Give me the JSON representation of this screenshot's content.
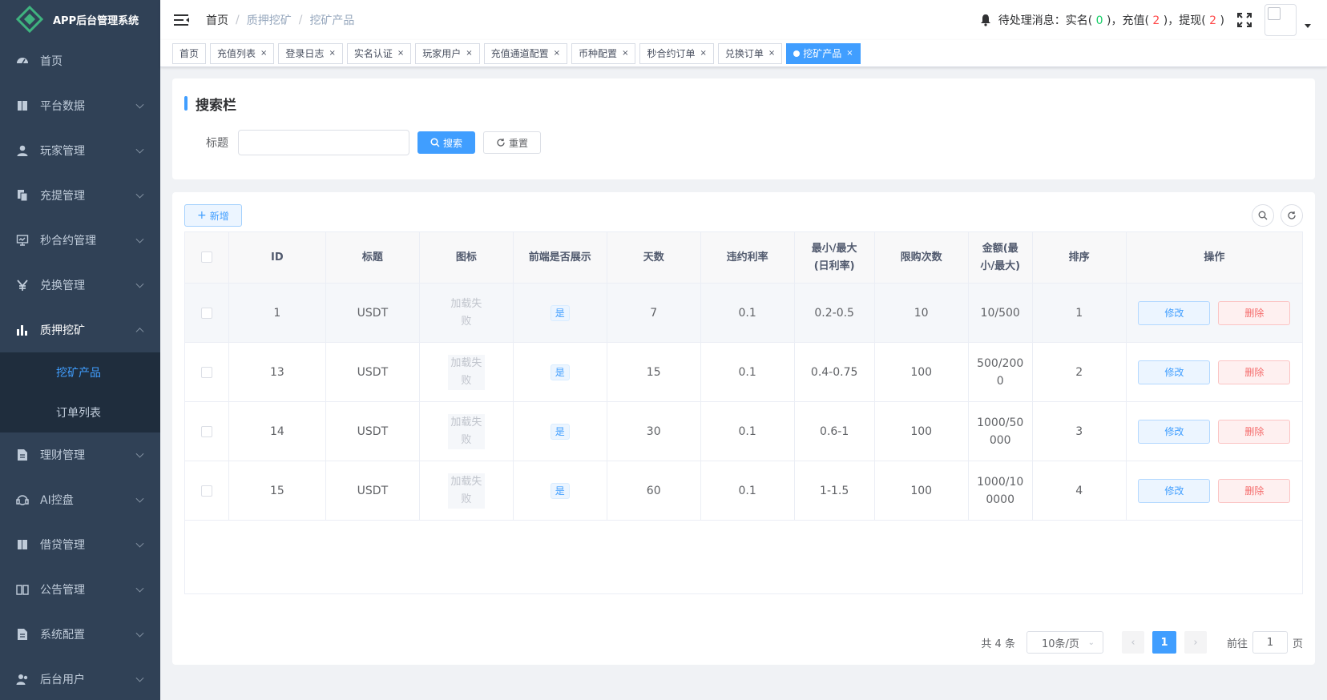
{
  "app": {
    "title": "APP后台管理系统"
  },
  "sidebar": {
    "items": [
      {
        "label": "首页",
        "icon": "dashboard-icon"
      },
      {
        "label": "平台数据",
        "icon": "book-icon"
      },
      {
        "label": "玩家管理",
        "icon": "user-icon"
      },
      {
        "label": "充提管理",
        "icon": "copy-icon"
      },
      {
        "label": "秒合约管理",
        "icon": "monitor-icon"
      },
      {
        "label": "兑换管理",
        "icon": "yen-icon"
      },
      {
        "label": "质押挖矿",
        "icon": "bar-chart-icon"
      },
      {
        "label": "理财管理",
        "icon": "document-icon"
      },
      {
        "label": "AI控盘",
        "icon": "robot-icon"
      },
      {
        "label": "借贷管理",
        "icon": "book-icon"
      },
      {
        "label": "公告管理",
        "icon": "open-book-icon"
      },
      {
        "label": "系统配置",
        "icon": "document-icon"
      },
      {
        "label": "后台用户",
        "icon": "users-icon"
      }
    ],
    "submenu": [
      {
        "label": "挖矿产品"
      },
      {
        "label": "订单列表"
      }
    ]
  },
  "breadcrumb": [
    "首页",
    "质押挖矿",
    "挖矿产品"
  ],
  "notice": {
    "prefix": "待处理消息：实名(",
    "realname": " 0 ",
    "recharge_label": ")，充值(",
    "recharge": " 2 ",
    "withdraw_label": ")，提现(",
    "withdraw": " 2 ",
    "suffix": ")"
  },
  "tags": [
    {
      "label": "首页",
      "closable": false
    },
    {
      "label": "充值列表",
      "closable": true
    },
    {
      "label": "登录日志",
      "closable": true
    },
    {
      "label": "实名认证",
      "closable": true
    },
    {
      "label": "玩家用户",
      "closable": true
    },
    {
      "label": "充值通道配置",
      "closable": true
    },
    {
      "label": "币种配置",
      "closable": true
    },
    {
      "label": "秒合约订单",
      "closable": true
    },
    {
      "label": "兑换订单",
      "closable": true
    },
    {
      "label": "挖矿产品",
      "closable": true,
      "active": true
    }
  ],
  "search": {
    "title": "搜索栏",
    "field_label": "标题",
    "field_value": "",
    "search_label": "搜索",
    "reset_label": "重置"
  },
  "table": {
    "add_label": "新增",
    "columns": [
      "ID",
      "标题",
      "图标",
      "前端是否展示",
      "天数",
      "违约利率",
      "最小/最大(日利率)",
      "限购次数",
      "金额(最小/最大)",
      "排序",
      "操作"
    ],
    "rows": [
      {
        "id": "1",
        "title": "USDT",
        "icon": "加载失败",
        "show": "是",
        "days": "7",
        "penalty": "0.1",
        "rate": "0.2-0.5",
        "limit": "10",
        "amount": "10/500",
        "sort": "1"
      },
      {
        "id": "13",
        "title": "USDT",
        "icon": "加载失败",
        "show": "是",
        "days": "15",
        "penalty": "0.1",
        "rate": "0.4-0.75",
        "limit": "100",
        "amount": "500/2000",
        "sort": "2"
      },
      {
        "id": "14",
        "title": "USDT",
        "icon": "加载失败",
        "show": "是",
        "days": "30",
        "penalty": "0.1",
        "rate": "0.6-1",
        "limit": "100",
        "amount": "1000/50000",
        "sort": "3"
      },
      {
        "id": "15",
        "title": "USDT",
        "icon": "加载失败",
        "show": "是",
        "days": "60",
        "penalty": "0.1",
        "rate": "1-1.5",
        "limit": "100",
        "amount": "1000/100000",
        "sort": "4"
      }
    ],
    "edit_label": "修改",
    "delete_label": "删除"
  },
  "pagination": {
    "total": "共 4 条",
    "page_size": "10条/页",
    "current": "1",
    "goto_label": "前往",
    "goto_value": "1",
    "page_suffix": "页"
  },
  "colors": {
    "primary": "#409eff",
    "sidebar": "#304156",
    "danger": "#f56c6c"
  }
}
